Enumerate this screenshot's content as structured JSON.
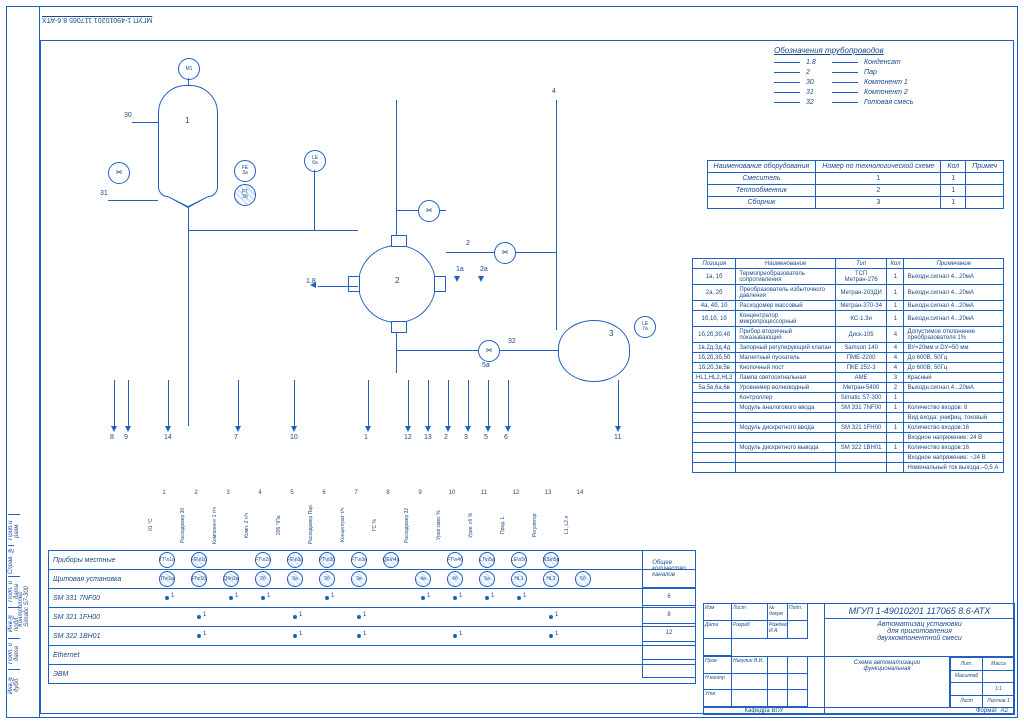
{
  "doc_number_rotated": "МГУП 1-49010201 117065 8.6-АТХ",
  "pipe_legend": {
    "title": "Обозначения трубопроводов",
    "rows": [
      {
        "code": "1.8",
        "name": "Конденсат"
      },
      {
        "code": "2",
        "name": "Пар"
      },
      {
        "code": "30",
        "name": "Компонент 1"
      },
      {
        "code": "31",
        "name": "Компонент 2"
      },
      {
        "code": "32",
        "name": "Готовая смесь"
      }
    ]
  },
  "equipment": {
    "headers": [
      "Наименование оборудования",
      "Номер по технологической схеме",
      "Кол",
      "Примеч"
    ],
    "rows": [
      {
        "name": "Смеситель",
        "num": "1",
        "qty": "1",
        "note": ""
      },
      {
        "name": "Теплообменник",
        "num": "2",
        "qty": "1",
        "note": ""
      },
      {
        "name": "Сборник",
        "num": "3",
        "qty": "1",
        "note": ""
      }
    ]
  },
  "instruments": {
    "headers": [
      "Позиция",
      "Наименование",
      "Тип",
      "Кол",
      "Примечание"
    ],
    "rows": [
      {
        "pos": "1а, 1б",
        "name": "Термопреобразователь сопротивления",
        "type": "ТСП Метран-276",
        "qty": "1",
        "note": "Выходн.сигнал 4...20мА"
      },
      {
        "pos": "2а, 2б",
        "name": "Преобразователь избыточного давления",
        "type": "Метран-203ДИ",
        "qty": "1",
        "note": "Выходн.сигнал 4...20мА"
      },
      {
        "pos": "4а, 4б, 1б",
        "name": "Расходомер массовый",
        "type": "Метран-370-34",
        "qty": "1",
        "note": "Выходн.сигнал 4...20мА"
      },
      {
        "pos": "1б,1б, 1б",
        "name": "Концентратор микропроцессорный",
        "type": "КС-1.3и",
        "qty": "1",
        "note": "Выходн.сигнал 4...20мА"
      },
      {
        "pos": "1б,2б,3б,4б",
        "name": "Прибор вторичный показывающий",
        "type": "Диск-105",
        "qty": "4",
        "note": "Допустимое отклонение преобразователя 1%"
      },
      {
        "pos": "1в,2д,3д,4д",
        "name": "Запорный регулирующий клапан",
        "type": "Samson 140",
        "qty": "4",
        "note": "ВУ=20мм и DУ=50 мм"
      },
      {
        "pos": "1б,2б,3б,5б",
        "name": "Магнитный пускатель",
        "type": "ПМЕ-2200",
        "qty": "4",
        "note": "До 600В, 50Гц"
      },
      {
        "pos": "1б,2б,3в,5в",
        "name": "Кнопочный пост",
        "type": "ПКЕ 252-3",
        "qty": "4",
        "note": "До 600В, 50Гц"
      },
      {
        "pos": "HL1,HL2,HL3",
        "name": "Лампа светосигнальная",
        "type": "АМЕ",
        "qty": "3",
        "note": "Красный"
      },
      {
        "pos": "5а,5в,6а,6в",
        "name": "Уровнемер волноводный",
        "type": "Метран-5400",
        "qty": "2",
        "note": "Выходн.сигнал 4...20мА"
      },
      {
        "pos": "",
        "name": "Контроллер",
        "type": "Simatic S7-300",
        "qty": "1",
        "note": ""
      },
      {
        "pos": "",
        "name": "Модуль аналогового ввода",
        "type": "SM 331 7NF00",
        "qty": "1",
        "note": "Количество входов: 8"
      },
      {
        "pos": "",
        "name": "",
        "type": "",
        "qty": "",
        "note": "Вид входа: унифиц. токовый"
      },
      {
        "pos": "",
        "name": "Модуль дискретного ввода",
        "type": "SM 321 1FH00",
        "qty": "1",
        "note": "Количество входов:16"
      },
      {
        "pos": "",
        "name": "",
        "type": "",
        "qty": "",
        "note": "Входное напряжение: 24 В"
      },
      {
        "pos": "",
        "name": "Модуль дискретного вывода",
        "type": "SM 322 1BH01",
        "qty": "1",
        "note": "Количество входов:16"
      },
      {
        "pos": "",
        "name": "",
        "type": "",
        "qty": "",
        "note": "Входное напряжение: ~24 В"
      },
      {
        "pos": "",
        "name": "",
        "type": "",
        "qty": "",
        "note": "Номинальный ток выхода:–0,5 А"
      }
    ]
  },
  "pid_labels": {
    "v1": "1",
    "v2": "2",
    "v3": "3",
    "m1": "M1",
    "l30": "30",
    "l31": "31",
    "l18": "1.8",
    "l32": "32",
    "l2": "2",
    "l1a": "1a",
    "l2a": "2a",
    "l4": "4",
    "bottom": [
      "8",
      "9",
      "14",
      "7",
      "10",
      "1",
      "12",
      "13",
      "2",
      "3",
      "5",
      "6",
      "11"
    ]
  },
  "channels": {
    "cols": [
      "1",
      "2",
      "3",
      "4",
      "5",
      "6",
      "7",
      "8",
      "9",
      "10",
      "11",
      "12",
      "13",
      "14"
    ],
    "col_labels": [
      "01 °C",
      "Расходомер 30",
      "Компонент 1 т/ч",
      "Комп. 2 т/ч",
      "205 °/Па",
      "Расходомер Пар",
      "Концентрат т/ч",
      "ГС %",
      "Расходомер 32",
      "Уров смес %",
      "Уров. сб %",
      "Пред. L",
      "Регулятор",
      "L1, L2 л"
    ],
    "rows": [
      {
        "label": "Приборы местные",
        "bubbles": [
          {
            "x": 0,
            "t": "TT\\n1а"
          },
          {
            "x": 1,
            "t": "FE\\n1б",
            "h": true
          },
          {
            "x": 3,
            "t": "FT\\n2а"
          },
          {
            "x": 4,
            "t": "FE\\n3а",
            "h": true
          },
          {
            "x": 5,
            "t": "PT\\n3б",
            "h": true
          },
          {
            "x": 6,
            "t": "FT\\n3в"
          },
          {
            "x": 7,
            "t": "QE\\n4а",
            "h": true
          },
          {
            "x": 9,
            "t": "FT\\n4б"
          },
          {
            "x": 10,
            "t": "LT\\n5а",
            "h": true
          },
          {
            "x": 11,
            "t": "LE\\n5б"
          },
          {
            "x": 12,
            "t": "NS\\n5в",
            "h": true
          }
        ]
      },
      {
        "label": "Щитовая установка",
        "bubbles": [
          {
            "x": 0,
            "t": "TI\\n1а",
            "h": true
          },
          {
            "x": 1,
            "t": "FI\\n1б",
            "h": true
          },
          {
            "x": 2,
            "t": "QI\\n2а",
            "h": true
          },
          {
            "x": 3,
            "t": "2б",
            "h": true
          },
          {
            "x": 4,
            "t": "3а",
            "h": true
          },
          {
            "x": 5,
            "t": "3б",
            "h": true
          },
          {
            "x": 6,
            "t": "3в",
            "h": true
          },
          {
            "x": 8,
            "t": "4а",
            "h": true
          },
          {
            "x": 9,
            "t": "4б",
            "h": true
          },
          {
            "x": 10,
            "t": "5а",
            "h": true
          },
          {
            "x": 11,
            "t": "HL1",
            "h": true
          },
          {
            "x": 12,
            "t": "HL2",
            "h": true
          },
          {
            "x": 13,
            "t": "5б",
            "h": true
          }
        ]
      },
      {
        "label": "SM 331 7NF00",
        "dots": [
          0,
          2,
          3,
          5,
          8,
          9,
          10,
          11
        ]
      },
      {
        "label": "SM 321 1FH00",
        "dots": [
          1,
          4,
          6,
          12
        ]
      },
      {
        "label": "SM 322 1BH01",
        "dots": [
          1,
          4,
          6,
          9,
          12
        ]
      },
      {
        "label": "Ethernet"
      },
      {
        "label": "ЭВМ"
      }
    ],
    "totals_label": "Общее\nколичество\nканалов",
    "totals": [
      "6",
      "8",
      "12"
    ]
  },
  "controller_label": "Контроллер\nSimatic S7-300",
  "left_tabs": [
    "Приб.и разм.",
    "Справ. №",
    "Подп. и дата",
    "Инв.№ подл.",
    "Подп. и дата",
    "Инв.№ дубл."
  ],
  "titleblock": {
    "docnum": "МГУП 1-49010201 117065 8.6-АТХ",
    "doctitle": "Автоматизац установки\nдля приготовления\nдвухкомпонентной смеси",
    "subtitle": "Схема автоматизации\nфункциональная",
    "sign_rows": [
      [
        "Изм",
        "Лист",
        "№ докум",
        "Подп.",
        "Дата"
      ],
      [
        "Разраб",
        "Раждев И.А.",
        "",
        ""
      ],
      [
        "Пров",
        "Никулин В.И.",
        "",
        ""
      ],
      [
        "Н.контр",
        "",
        "",
        ""
      ],
      [
        "Утв",
        "",
        "",
        ""
      ]
    ],
    "rcells": [
      "Лит.",
      "Масса",
      "Масштаб",
      "",
      "",
      "1:1",
      "Лист",
      "Листов 1"
    ],
    "org": "Кафедра\nВПУ",
    "fmt_l": "Формат",
    "fmt_r": "А2"
  }
}
